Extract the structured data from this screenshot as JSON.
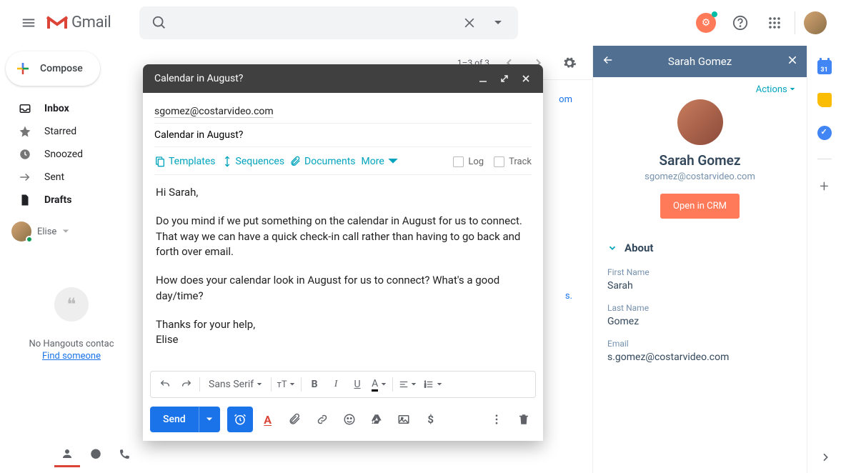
{
  "header": {
    "product": "Gmail"
  },
  "sidebar": {
    "compose": "Compose",
    "items": [
      {
        "label": "Inbox",
        "bold": true,
        "icon": "inbox"
      },
      {
        "label": "Starred",
        "bold": false,
        "icon": "star"
      },
      {
        "label": "Snoozed",
        "bold": false,
        "icon": "clock"
      },
      {
        "label": "Sent",
        "bold": false,
        "icon": "send"
      },
      {
        "label": "Drafts",
        "bold": true,
        "icon": "file"
      }
    ],
    "user": "Elise",
    "hangouts_text": "No Hangouts contac",
    "find_link": "Find someone"
  },
  "toolbar": {
    "range": "1–3 of 3"
  },
  "compose": {
    "title": "Calendar in August?",
    "to": "sgomez@costarvideo.com",
    "subject": "Calendar in August?",
    "hs_tools": {
      "templates": "Templates",
      "sequences": "Sequences",
      "documents": "Documents",
      "more": "More"
    },
    "log": "Log",
    "track": "Track",
    "body": {
      "l1": "Hi Sarah,",
      "l2": "Do you mind if we put something on the calendar in August for us to connect. That way we can have a quick check-in call rather than having to go back and forth over email.",
      "l3": "How does your calendar look in August for us to connect? What's a good day/time?",
      "l4": "Thanks for your help,\nElise"
    },
    "font": "Sans Serif",
    "send": "Send"
  },
  "hs_panel": {
    "title": "Sarah Gomez",
    "actions": "Actions",
    "name": "Sarah Gomez",
    "email": "sgomez@costarvideo.com",
    "open_crm": "Open in CRM",
    "section_about": "About",
    "fields": {
      "first_name_label": "First Name",
      "first_name_value": "Sarah",
      "last_name_label": "Last Name",
      "last_name_value": "Gomez",
      "email_label": "Email",
      "email_value": "s.gomez@costarvideo.com"
    }
  },
  "addon": {
    "cal_day": "31"
  },
  "peek": {
    "p1": "om",
    "p2": "s."
  }
}
